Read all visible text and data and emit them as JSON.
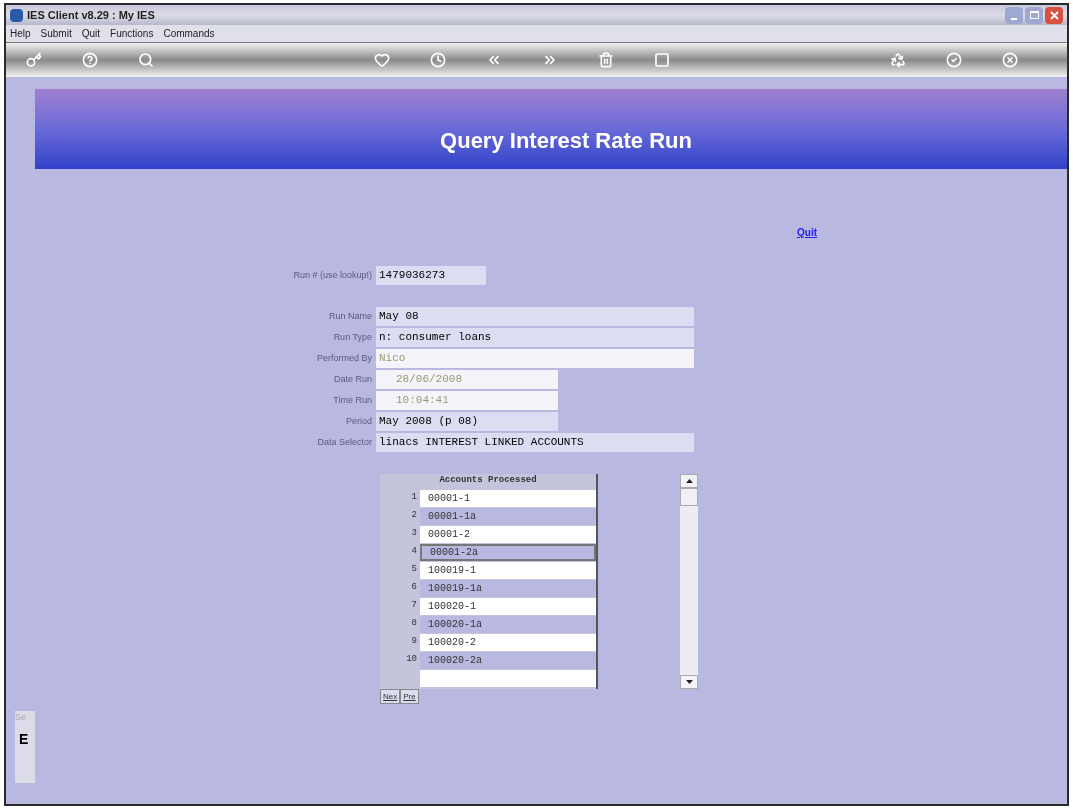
{
  "window": {
    "title": "IES Client v8.29 : My IES"
  },
  "menu": [
    "Help",
    "Submit",
    "Quit",
    "Functions",
    "Commands"
  ],
  "banner": {
    "title": "Query Interest Rate Run"
  },
  "quit_link": "Quit",
  "form": [
    {
      "label": "Run # (use lookup!)",
      "value": "1479036273",
      "kind": "short"
    },
    {
      "label": "Run Name",
      "value": "May 08",
      "kind": "wide"
    },
    {
      "label": "Run Type",
      "value": "n: consumer loans",
      "kind": "wide"
    },
    {
      "label": "Performed By",
      "value": "Nico",
      "kind": "wide-dim"
    },
    {
      "label": "Date Run",
      "value": "28/06/2008",
      "kind": "mid-dim"
    },
    {
      "label": "Time Run",
      "value": "10:04:41",
      "kind": "mid-dim"
    },
    {
      "label": "Period",
      "value": "May 2008 (p 08)",
      "kind": "mid"
    },
    {
      "label": "Data Selector",
      "value": "linacs INTEREST LINKED ACCOUNTS",
      "kind": "wide"
    }
  ],
  "accounts": {
    "header": "Accounts Processed",
    "rows": [
      {
        "num": "1",
        "account": "00001-1",
        "selected": false
      },
      {
        "num": "2",
        "account": "00001-1a",
        "selected": false
      },
      {
        "num": "3",
        "account": "00001-2",
        "selected": false
      },
      {
        "num": "4",
        "account": "00001-2a",
        "selected": true
      },
      {
        "num": "5",
        "account": "100019-1",
        "selected": false
      },
      {
        "num": "6",
        "account": "100019-1a",
        "selected": false
      },
      {
        "num": "7",
        "account": "100020-1",
        "selected": false
      },
      {
        "num": "8",
        "account": "100020-1a",
        "selected": false
      },
      {
        "num": "9",
        "account": "100020-2",
        "selected": false
      },
      {
        "num": "10",
        "account": "100020-2a",
        "selected": false
      }
    ]
  },
  "pager": [
    "Nex",
    "Pre"
  ],
  "side_panel": {
    "label": "Se",
    "glyph": "E"
  }
}
